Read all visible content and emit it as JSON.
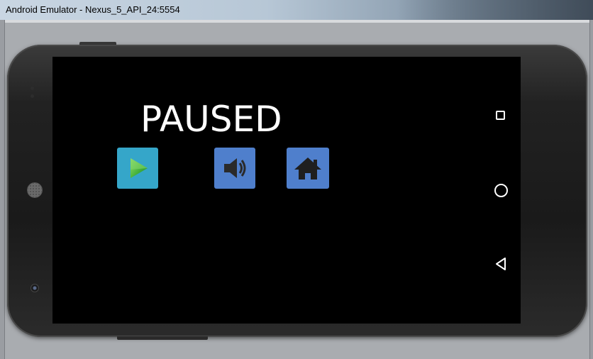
{
  "window": {
    "title": "Android Emulator - Nexus_5_API_24:5554"
  },
  "game": {
    "paused_title": "PAUSED",
    "buttons": [
      {
        "name": "play",
        "icon": "play-icon",
        "color": "#35a6c9"
      },
      {
        "name": "sound",
        "icon": "speaker-icon",
        "color": "#4f7fcc"
      },
      {
        "name": "home",
        "icon": "home-icon",
        "color": "#4f7fcc"
      }
    ]
  },
  "nav_bar": {
    "items": [
      "recent-apps-icon",
      "home-circle-icon",
      "back-triangle-icon"
    ]
  },
  "colors": {
    "screen_background": "#000000",
    "play_button": "#35a6c9",
    "menu_button": "#4f7fcc",
    "text": "#ffffff"
  }
}
